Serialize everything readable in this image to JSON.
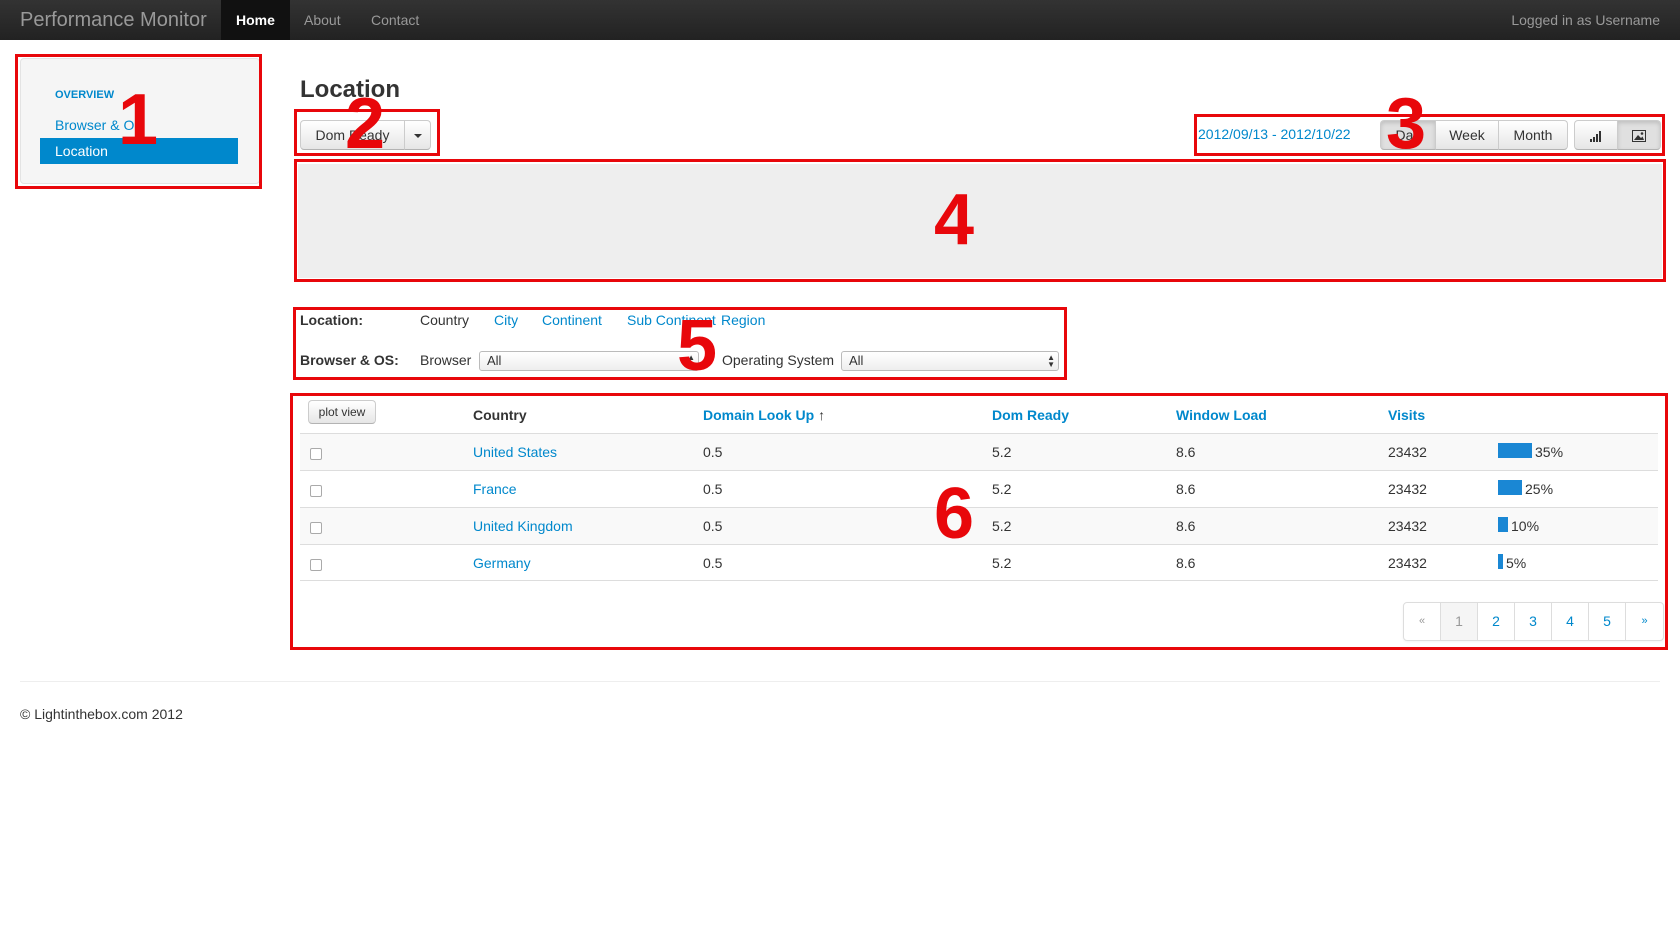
{
  "navbar": {
    "brand": "Performance Monitor",
    "items": [
      {
        "label": "Home",
        "active": true
      },
      {
        "label": "About",
        "active": false
      },
      {
        "label": "Contact",
        "active": false
      }
    ],
    "user_text": "Logged in as Username"
  },
  "sidebar": {
    "header": "OVERVIEW",
    "items": [
      {
        "label": "Browser & OS",
        "active": false
      },
      {
        "label": "Location",
        "active": true
      }
    ]
  },
  "page": {
    "title": "Location",
    "metric_button": "Dom Ready"
  },
  "toolbar": {
    "date_range": "2012/09/13 - 2012/10/22",
    "periods": [
      {
        "label": "Day",
        "active": true
      },
      {
        "label": "Week",
        "active": false
      },
      {
        "label": "Month",
        "active": false
      }
    ],
    "view_icons": [
      "bar-chart-icon",
      "picture-icon"
    ]
  },
  "filters": {
    "location_label": "Location:",
    "location_options": [
      {
        "label": "Country",
        "active": true
      },
      {
        "label": "City",
        "active": false
      },
      {
        "label": "Continent",
        "active": false
      },
      {
        "label": "Sub Continent",
        "active": false
      },
      {
        "label": "Region",
        "active": false
      }
    ],
    "browser_os_label": "Browser & OS:",
    "browser_label": "Browser",
    "browser_value": "All",
    "os_label": "Operating System",
    "os_value": "All"
  },
  "table": {
    "plot_button": "plot view",
    "columns": [
      "Country",
      "Domain Look Up",
      "Dom Ready",
      "Window Load",
      "Visits"
    ],
    "sort_indicator": "↑",
    "rows": [
      {
        "country": "United States",
        "domain_lookup": "0.5",
        "dom_ready": "5.2",
        "window_load": "8.6",
        "visits": "23432",
        "share": "35%",
        "share_value": 35
      },
      {
        "country": "France",
        "domain_lookup": "0.5",
        "dom_ready": "5.2",
        "window_load": "8.6",
        "visits": "23432",
        "share": "25%",
        "share_value": 25
      },
      {
        "country": "United Kingdom",
        "domain_lookup": "0.5",
        "dom_ready": "5.2",
        "window_load": "8.6",
        "visits": "23432",
        "share": "10%",
        "share_value": 10
      },
      {
        "country": "Germany",
        "domain_lookup": "0.5",
        "dom_ready": "5.2",
        "window_load": "8.6",
        "visits": "23432",
        "share": "5%",
        "share_value": 5
      }
    ]
  },
  "pagination": {
    "prev": "«",
    "pages": [
      "1",
      "2",
      "3",
      "4",
      "5"
    ],
    "active_page": "1",
    "next": "»"
  },
  "footer": "© Lightinthebox.com 2012",
  "annotations": [
    "1",
    "2",
    "3",
    "4",
    "5",
    "6"
  ],
  "colors": {
    "annotation": "#e8070b",
    "accent": "#0088cc",
    "bar": "#1a87d4"
  }
}
